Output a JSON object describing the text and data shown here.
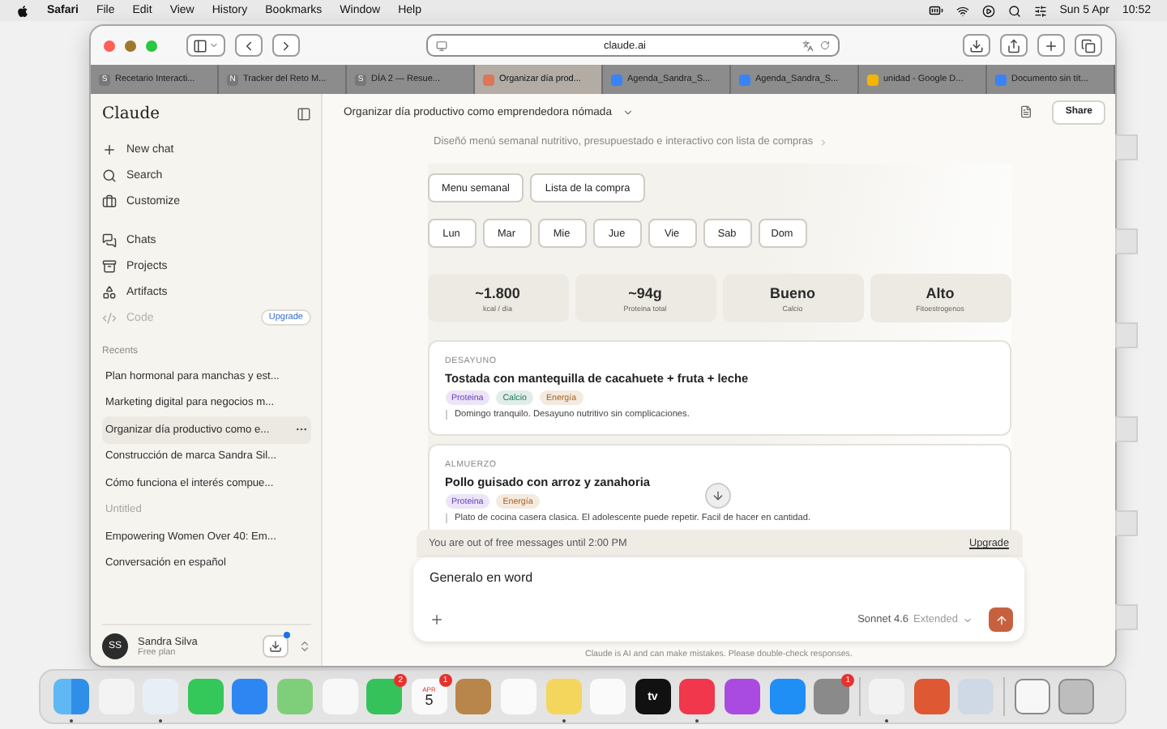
{
  "menu_bar": {
    "app": "Safari",
    "items": [
      "File",
      "Edit",
      "View",
      "History",
      "Bookmarks",
      "Window",
      "Help"
    ],
    "date": "Sun 5 Apr",
    "time": "10:52"
  },
  "browser": {
    "address": "claude.ai",
    "tabs": [
      {
        "title": "Recetario Interacti...",
        "kind": "letter",
        "favicon_text": "S",
        "selected": false
      },
      {
        "title": "Tracker del Reto M...",
        "kind": "letter",
        "favicon_text": "N",
        "selected": false
      },
      {
        "title": "DÍA 2 — Resue...",
        "kind": "letter",
        "favicon_text": "S",
        "selected": false
      },
      {
        "title": "Organizar día prod...",
        "kind": "claude",
        "selected": true
      },
      {
        "title": "Agenda_Sandra_S...",
        "kind": "docs",
        "selected": false
      },
      {
        "title": "Agenda_Sandra_S...",
        "kind": "docs",
        "selected": false
      },
      {
        "title": "unidad - Google D...",
        "kind": "drive",
        "selected": false
      },
      {
        "title": "Documento sin tít...",
        "kind": "docs",
        "selected": false
      }
    ]
  },
  "sidebar": {
    "logo": "Claude",
    "nav": [
      {
        "kind": "new",
        "label": "New chat",
        "disabled": false
      },
      {
        "kind": "search",
        "label": "Search",
        "disabled": false
      },
      {
        "kind": "customize",
        "label": "Customize",
        "disabled": false
      },
      {
        "kind": "chats",
        "label": "Chats",
        "disabled": false
      },
      {
        "kind": "projects",
        "label": "Projects",
        "disabled": false
      },
      {
        "kind": "artifacts",
        "label": "Artifacts",
        "disabled": false
      },
      {
        "kind": "code",
        "label": "Code",
        "disabled": true,
        "badge": "Upgrade"
      }
    ],
    "recents_label": "Recents",
    "recents": [
      {
        "title": "Plan hormonal para manchas y est...",
        "selected": false,
        "muted": false
      },
      {
        "title": "Marketing digital para negocios m...",
        "selected": false,
        "muted": false
      },
      {
        "title": "Organizar día productivo como e...",
        "selected": true,
        "muted": false
      },
      {
        "title": "Construcción de marca Sandra Sil...",
        "selected": false,
        "muted": false
      },
      {
        "title": "Cómo funciona el interés compue...",
        "selected": false,
        "muted": false
      },
      {
        "title": "Untitled",
        "selected": false,
        "muted": true
      },
      {
        "title": "Empowering Women Over 40: Em...",
        "selected": false,
        "muted": false
      },
      {
        "title": "Conversación en español",
        "selected": false,
        "muted": false
      }
    ],
    "user": {
      "initials": "SS",
      "name": "Sandra Silva",
      "plan": "Free plan",
      "notification": true
    }
  },
  "chat": {
    "title": "Organizar día productivo como emprendedora nómada",
    "share": "Share",
    "summary": "Diseñó menú semanal nutritivo, presupuestado e interactivo con lista de compras",
    "artifact": {
      "views": [
        "Menu semanal",
        "Lista de la compra"
      ],
      "days": [
        "Lun",
        "Mar",
        "Mie",
        "Jue",
        "Vie",
        "Sab",
        "Dom"
      ],
      "stats": [
        {
          "value": "~1.800",
          "label": "kcal / día"
        },
        {
          "value": "~94g",
          "label": "Proteina total"
        },
        {
          "value": "Bueno",
          "label": "Calcio"
        },
        {
          "value": "Alto",
          "label": "Fitoestrogenos"
        }
      ],
      "meals": [
        {
          "label": "DESAYUNO",
          "title": "Tostada con mantequilla de cacahuete + fruta + leche",
          "tags": [
            {
              "text": "Proteina",
              "color": "#6b3fc4"
            },
            {
              "text": "Calcio",
              "color": "#1f7a5a"
            },
            {
              "text": "Energía",
              "color": "#a8641a"
            }
          ],
          "note": "Domingo tranquilo. Desayuno nutritivo sin complicaciones."
        },
        {
          "label": "ALMUERZO",
          "title": "Pollo guisado con arroz y zanahoria",
          "tags": [
            {
              "text": "Proteina",
              "color": "#6b3fc4"
            },
            {
              "text": "Energía",
              "color": "#a8641a"
            }
          ],
          "note": "Plato de cocina casera clasica. El adolescente puede repetir. Facil de hacer en cantidad."
        }
      ]
    },
    "limit_banner": {
      "text": "You are out of free messages until 2:00 PM",
      "action": "Upgrade"
    },
    "composer": {
      "value": "Generalo en word",
      "model": "Sonnet 4.6",
      "mode": "Extended"
    },
    "disclaimer": "Claude is AI and can make mistakes. Please double-check responses."
  },
  "dock": [
    {
      "kind": "finder",
      "running": true
    },
    {
      "kind": "launchpad",
      "running": false
    },
    {
      "kind": "safari",
      "running": true
    },
    {
      "kind": "messages",
      "running": false
    },
    {
      "kind": "mail",
      "running": false
    },
    {
      "kind": "maps",
      "running": false
    },
    {
      "kind": "photos",
      "running": false
    },
    {
      "kind": "facetime",
      "running": false,
      "badge": "2"
    },
    {
      "kind": "calendar",
      "running": false,
      "badge": "1",
      "month": "APR",
      "day": "5"
    },
    {
      "kind": "contacts",
      "running": false
    },
    {
      "kind": "reminders",
      "running": false
    },
    {
      "kind": "notes",
      "running": true
    },
    {
      "kind": "freeform",
      "running": false
    },
    {
      "kind": "tv",
      "running": false,
      "label": "tv"
    },
    {
      "kind": "music",
      "running": true
    },
    {
      "kind": "podcasts",
      "running": false
    },
    {
      "kind": "appstore",
      "running": false
    },
    {
      "kind": "settings",
      "running": false,
      "badge": "1"
    },
    {
      "kind": "separator"
    },
    {
      "kind": "passwords",
      "running": true
    },
    {
      "kind": "duckduckgo",
      "running": false
    },
    {
      "kind": "preview",
      "running": false
    },
    {
      "kind": "separator"
    },
    {
      "kind": "document",
      "running": false
    },
    {
      "kind": "trash",
      "running": false
    }
  ]
}
